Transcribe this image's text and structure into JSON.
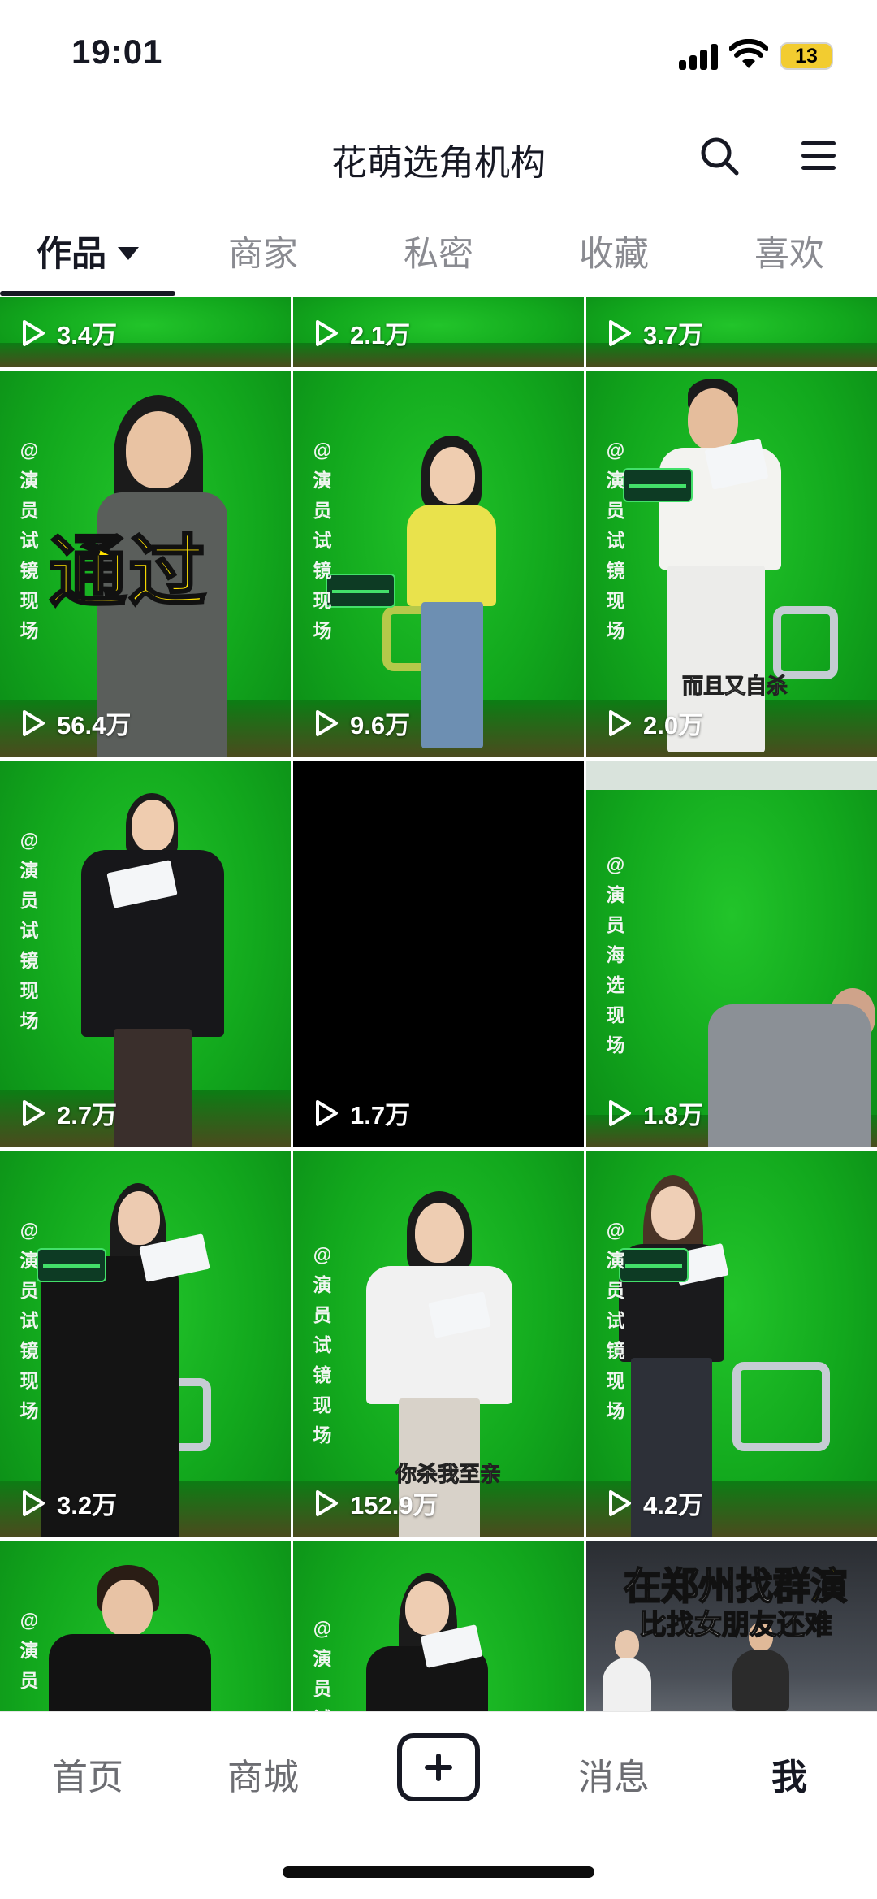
{
  "status_bar": {
    "time": "19:01",
    "battery": "13"
  },
  "header": {
    "title": "花萌选角机构",
    "search_icon": "search-icon",
    "menu_icon": "menu-icon"
  },
  "tabs": [
    {
      "label": "作品",
      "active": true
    },
    {
      "label": "商家",
      "active": false
    },
    {
      "label": "私密",
      "active": false
    },
    {
      "label": "收藏",
      "active": false
    },
    {
      "label": "喜欢",
      "active": false
    }
  ],
  "videos": [
    {
      "views": "3.4万"
    },
    {
      "views": "2.1万"
    },
    {
      "views": "3.7万"
    },
    {
      "views": "56.4万",
      "tag": "@演员试镜现场",
      "caption": "通过"
    },
    {
      "views": "9.6万",
      "tag": "@演员试镜现场"
    },
    {
      "views": "2.0万",
      "tag": "@演员试镜现场",
      "subtitle": "而且又自杀"
    },
    {
      "views": "2.7万",
      "tag": "@演员试镜现场"
    },
    {
      "views": "1.7万"
    },
    {
      "views": "1.8万",
      "tag": "@演员海选现场"
    },
    {
      "views": "3.2万",
      "tag": "@演员试镜现场"
    },
    {
      "views": "152.9万",
      "tag": "@演员试镜现场",
      "subtitle": "你杀我至亲"
    },
    {
      "views": "4.2万",
      "tag": "@演员试镜现场"
    },
    {
      "views": "",
      "tag": "@演员"
    },
    {
      "views": "",
      "tag": "@演员试"
    },
    {
      "views": "",
      "banner_line1_a": "在郑州找",
      "banner_line1_b": "群演",
      "banner_line2": "比找女朋友还难"
    }
  ],
  "bottom_nav": {
    "home": "首页",
    "mall": "商城",
    "messages": "消息",
    "me": "我"
  },
  "colors": {
    "green_screen": "#12a81d",
    "text_primary": "#161823",
    "text_secondary": "#8a8b91",
    "caption_yellow": "#ffe100"
  }
}
